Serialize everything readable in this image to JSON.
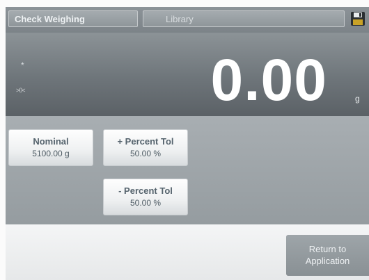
{
  "tabs": {
    "application": "Check Weighing",
    "library": "Library"
  },
  "icons": {
    "save": "save-icon"
  },
  "display": {
    "star": "*",
    "zero_indicator": ">0<",
    "weight": "0.00",
    "unit": "g"
  },
  "params": {
    "nominal": {
      "label": "Nominal",
      "value": "5100.00 g"
    },
    "plus_tol": {
      "label": "+ Percent Tol",
      "value": "50.00 %"
    },
    "minus_tol": {
      "label": "- Percent Tol",
      "value": "50.00 %"
    }
  },
  "bottom": {
    "return_line1": "Return to",
    "return_line2": "Application"
  },
  "colors": {
    "display_bg": "#6e757a",
    "button_text": "#55636d",
    "return_bg": "#899094"
  }
}
